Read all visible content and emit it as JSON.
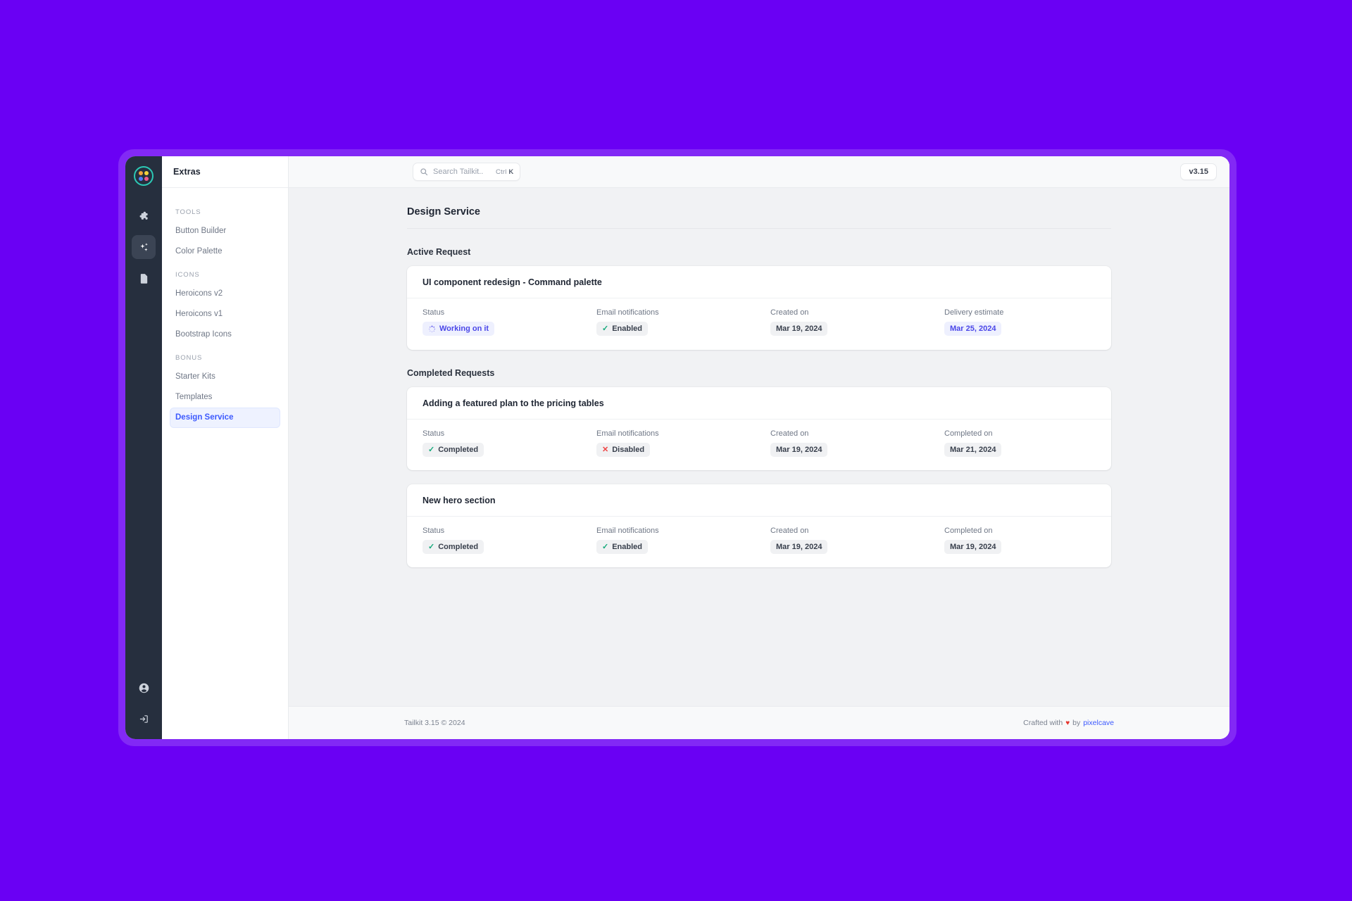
{
  "app": {
    "background_color": "#6a00f4",
    "brand": "Extras",
    "version_badge": "v3.15"
  },
  "rail": {
    "logo_icon": "tailkit-logo-icon",
    "items": [
      {
        "icon": "puzzle-piece-icon",
        "active": false
      },
      {
        "icon": "sparkles-icon",
        "active": true
      },
      {
        "icon": "document-icon",
        "active": false
      }
    ],
    "bottom_items": [
      {
        "icon": "user-circle-icon"
      },
      {
        "icon": "sign-out-icon"
      }
    ]
  },
  "sidebar": {
    "header": "Extras",
    "groups": [
      {
        "label": "TOOLS",
        "items": [
          {
            "label": "Button Builder",
            "active": false
          },
          {
            "label": "Color Palette",
            "active": false
          }
        ]
      },
      {
        "label": "ICONS",
        "items": [
          {
            "label": "Heroicons v2",
            "active": false
          },
          {
            "label": "Heroicons v1",
            "active": false
          },
          {
            "label": "Bootstrap Icons",
            "active": false
          }
        ]
      },
      {
        "label": "BONUS",
        "items": [
          {
            "label": "Starter Kits",
            "active": false
          },
          {
            "label": "Templates",
            "active": false
          },
          {
            "label": "Design Service",
            "active": true
          }
        ]
      }
    ]
  },
  "topbar": {
    "search": {
      "icon": "search-icon",
      "placeholder": "Search Tailkit..",
      "value": "",
      "shortcut_prefix": "Ctrl ",
      "shortcut_key": "K"
    },
    "version": "v3.15"
  },
  "page": {
    "title": "Design Service",
    "sections": [
      {
        "title": "Active Request",
        "cards": [
          {
            "title": "UI component redesign - Command palette",
            "fields": [
              {
                "label": "Status",
                "value": "Working on it",
                "icon": "spinner-icon",
                "style": "indigo"
              },
              {
                "label": "Email notifications",
                "value": "Enabled",
                "icon": "check-icon",
                "style": "neutral"
              },
              {
                "label": "Created on",
                "value": "Mar 19, 2024",
                "icon": "",
                "style": "plain"
              },
              {
                "label": "Delivery estimate",
                "value": "Mar 25, 2024",
                "icon": "",
                "style": "indigo"
              }
            ]
          }
        ]
      },
      {
        "title": "Completed Requests",
        "cards": [
          {
            "title": "Adding a featured plan to the pricing tables",
            "fields": [
              {
                "label": "Status",
                "value": "Completed",
                "icon": "check-icon",
                "style": "neutral"
              },
              {
                "label": "Email notifications",
                "value": "Disabled",
                "icon": "cross-icon",
                "style": "neutral"
              },
              {
                "label": "Created on",
                "value": "Mar 19, 2024",
                "icon": "",
                "style": "plain"
              },
              {
                "label": "Completed on",
                "value": "Mar 21, 2024",
                "icon": "",
                "style": "plain"
              }
            ]
          },
          {
            "title": "New hero section",
            "fields": [
              {
                "label": "Status",
                "value": "Completed",
                "icon": "check-icon",
                "style": "neutral"
              },
              {
                "label": "Email notifications",
                "value": "Enabled",
                "icon": "check-icon",
                "style": "neutral"
              },
              {
                "label": "Created on",
                "value": "Mar 19, 2024",
                "icon": "",
                "style": "plain"
              },
              {
                "label": "Completed on",
                "value": "Mar 19, 2024",
                "icon": "",
                "style": "plain"
              }
            ]
          }
        ]
      }
    ]
  },
  "footer": {
    "left": "Tailkit 3.15 © 2024",
    "crafted_prefix": "Crafted with",
    "heart": "♥",
    "by": "by",
    "author": "pixelcave"
  }
}
